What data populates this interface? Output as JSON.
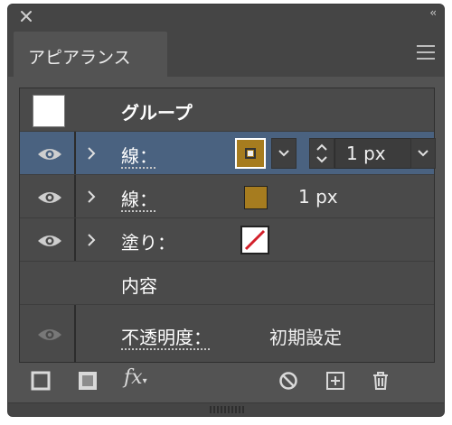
{
  "panel": {
    "tab_label": "アピアランス",
    "title": "グループ",
    "rows": [
      {
        "label": "線：",
        "value": "1 px"
      },
      {
        "label": "線：",
        "value": "1 px"
      },
      {
        "label": "塗り："
      },
      {
        "label": "内容"
      },
      {
        "label": "不透明度：",
        "value": "初期設定"
      }
    ],
    "fx_label": "fx",
    "colors": {
      "panel_bg": "#535353",
      "selected_row": "#4a6280",
      "stroke_color": "#a67c1f",
      "none_swatch_red": "#d21f2a"
    },
    "icons": [
      "close-icon",
      "collapse-icon",
      "panel-menu-icon",
      "eye-icon",
      "chevron-right-icon",
      "chevron-down-icon",
      "spinner-icon",
      "add-stroke-icon",
      "add-fill-icon",
      "fx-icon",
      "clear-appearance-icon",
      "duplicate-item-icon",
      "trash-icon"
    ]
  }
}
